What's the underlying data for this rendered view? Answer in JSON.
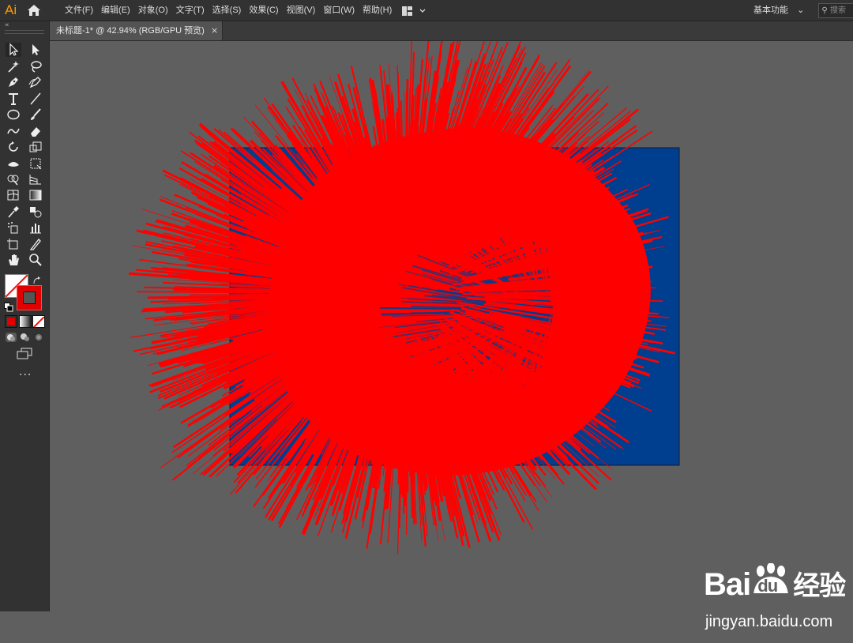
{
  "app": {
    "logo": "Ai"
  },
  "menu": [
    "文件(F)",
    "编辑(E)",
    "对象(O)",
    "文字(T)",
    "选择(S)",
    "效果(C)",
    "视图(V)",
    "窗口(W)",
    "帮助(H)"
  ],
  "workspace": {
    "label": "基本功能",
    "arrow": "⌄"
  },
  "search": {
    "placeholder": "搜索"
  },
  "document": {
    "tab_title": "未标题-1* @ 42.94% (RGB/GPU 预览)",
    "close": "×"
  },
  "toolbar": {
    "collapse": "«",
    "more": "..."
  },
  "artwork": {
    "background_color": "#003e8f",
    "burst_color": "#ff0000"
  },
  "watermark": {
    "brand_latin": "Bai",
    "brand_du": "du",
    "brand_cn": "经验",
    "url": "jingyan.baidu.com"
  }
}
